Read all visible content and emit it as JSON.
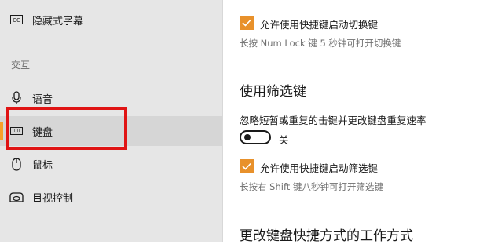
{
  "sidebar": {
    "items": [
      {
        "label": "隐藏式字幕",
        "icon": "closed-caption-icon"
      },
      {
        "label": "语音",
        "icon": "microphone-icon"
      },
      {
        "label": "键盘",
        "icon": "keyboard-icon",
        "active": true
      },
      {
        "label": "鼠标",
        "icon": "mouse-icon"
      },
      {
        "label": "目视控制",
        "icon": "eye-control-icon"
      }
    ],
    "section_header": "交互",
    "accent_color": "#f7a029",
    "highlight_color": "#e01414"
  },
  "content": {
    "toggle_keys": {
      "checkbox_label": "允许使用快捷键启动切换键",
      "checked": true,
      "hint": "长按 Num Lock 键 5 秒钟可打开切换键"
    },
    "filter_keys": {
      "heading": "使用筛选键",
      "description": "忽略短暂或重复的击键并更改键盘重复速率",
      "toggle_state": "关",
      "toggle_on": false,
      "checkbox_label": "允许使用快捷键启动筛选键",
      "checked": true,
      "hint": "长按右 Shift 键八秒钟可打开筛选键"
    },
    "shortcut_section": {
      "heading": "更改键盘快捷方式的工作方式"
    },
    "checkbox_color": "#e8912b"
  }
}
